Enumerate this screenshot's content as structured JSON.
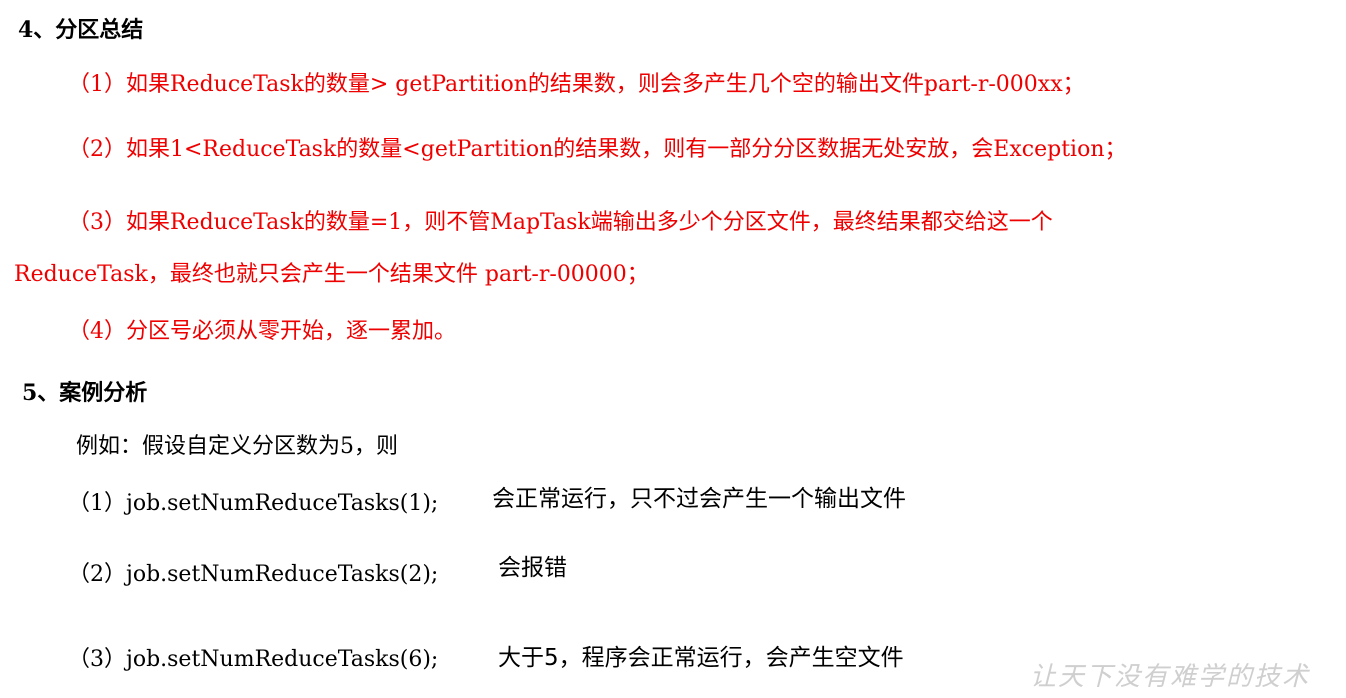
{
  "sections": {
    "summary": {
      "heading": "4、分区总结",
      "items": [
        "（1）如果ReduceTask的数量> getPartition的结果数，则会多产生几个空的输出文件part-r-000xx；",
        "（2）如果1<ReduceTask的数量<getPartition的结果数，则有一部分分区数据无处安放，会Exception；",
        "（3）如果ReduceTask的数量=1，则不管MapTask端输出多少个分区文件，最终结果都交给这一个",
        "ReduceTask，最终也就只会产生一个结果文件 part-r-00000；",
        "（4）分区号必须从零开始，逐一累加。"
      ]
    },
    "case": {
      "heading": "5、案例分析",
      "intro": "例如：假设自定义分区数为5，则",
      "rows": [
        {
          "code": "（1）job.setNumReduceTasks(1);",
          "result": "会正常运行，只不过会产生一个输出文件"
        },
        {
          "code": "（2）job.setNumReduceTasks(2);",
          "result": "会报错"
        },
        {
          "code": "（3）job.setNumReduceTasks(6);",
          "result": "大于5，程序会正常运行，会产生空文件"
        }
      ]
    }
  },
  "watermark": "让天下没有难学的技术",
  "colors": {
    "emphasis": "#ee0000",
    "text": "#000000",
    "watermark": "#cfcfcf"
  }
}
